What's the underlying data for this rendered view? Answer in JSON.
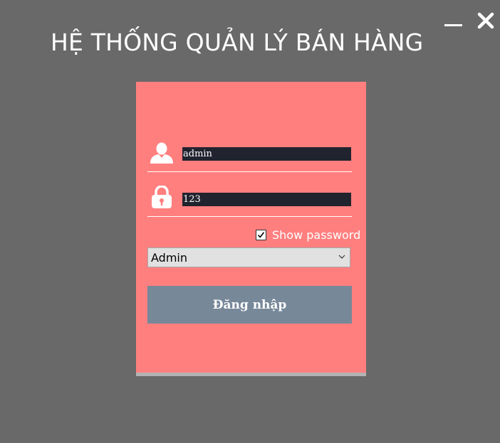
{
  "header": {
    "title": "HỆ THỐNG QUẢN LÝ BÁN HÀNG"
  },
  "window_controls": {
    "minimize_icon": "minimize-icon",
    "close_icon": "close-icon"
  },
  "login": {
    "username_icon": "user-icon",
    "username_value": "admin",
    "password_icon": "lock-icon",
    "password_value": "123",
    "show_password_checked": true,
    "show_password_label": "Show password",
    "role_selected": "Admin",
    "submit_label": "Đăng nhập"
  },
  "colors": {
    "background": "#696969",
    "panel": "#ff7f7f",
    "field_background": "#21232f",
    "button": "#778899"
  }
}
